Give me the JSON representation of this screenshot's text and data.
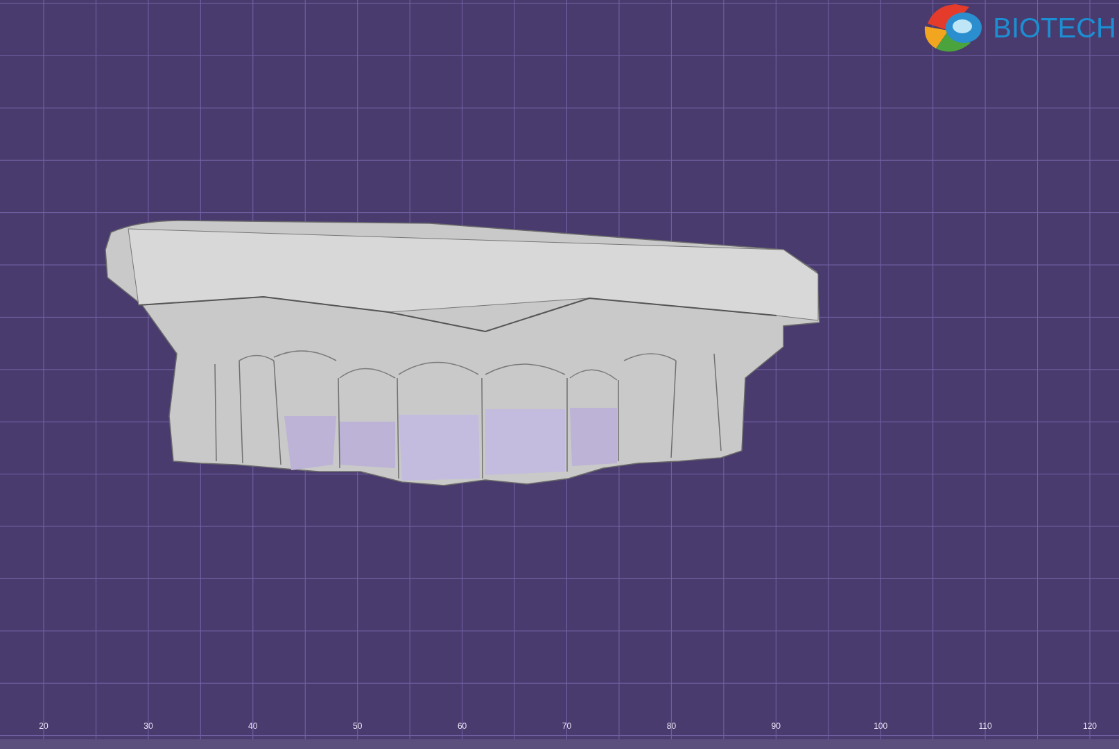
{
  "logo": {
    "text": "BIOTECH"
  },
  "ruler": {
    "labels": [
      "20",
      "30",
      "40",
      "50",
      "60",
      "70",
      "80",
      "90",
      "100",
      "110",
      "120"
    ]
  }
}
